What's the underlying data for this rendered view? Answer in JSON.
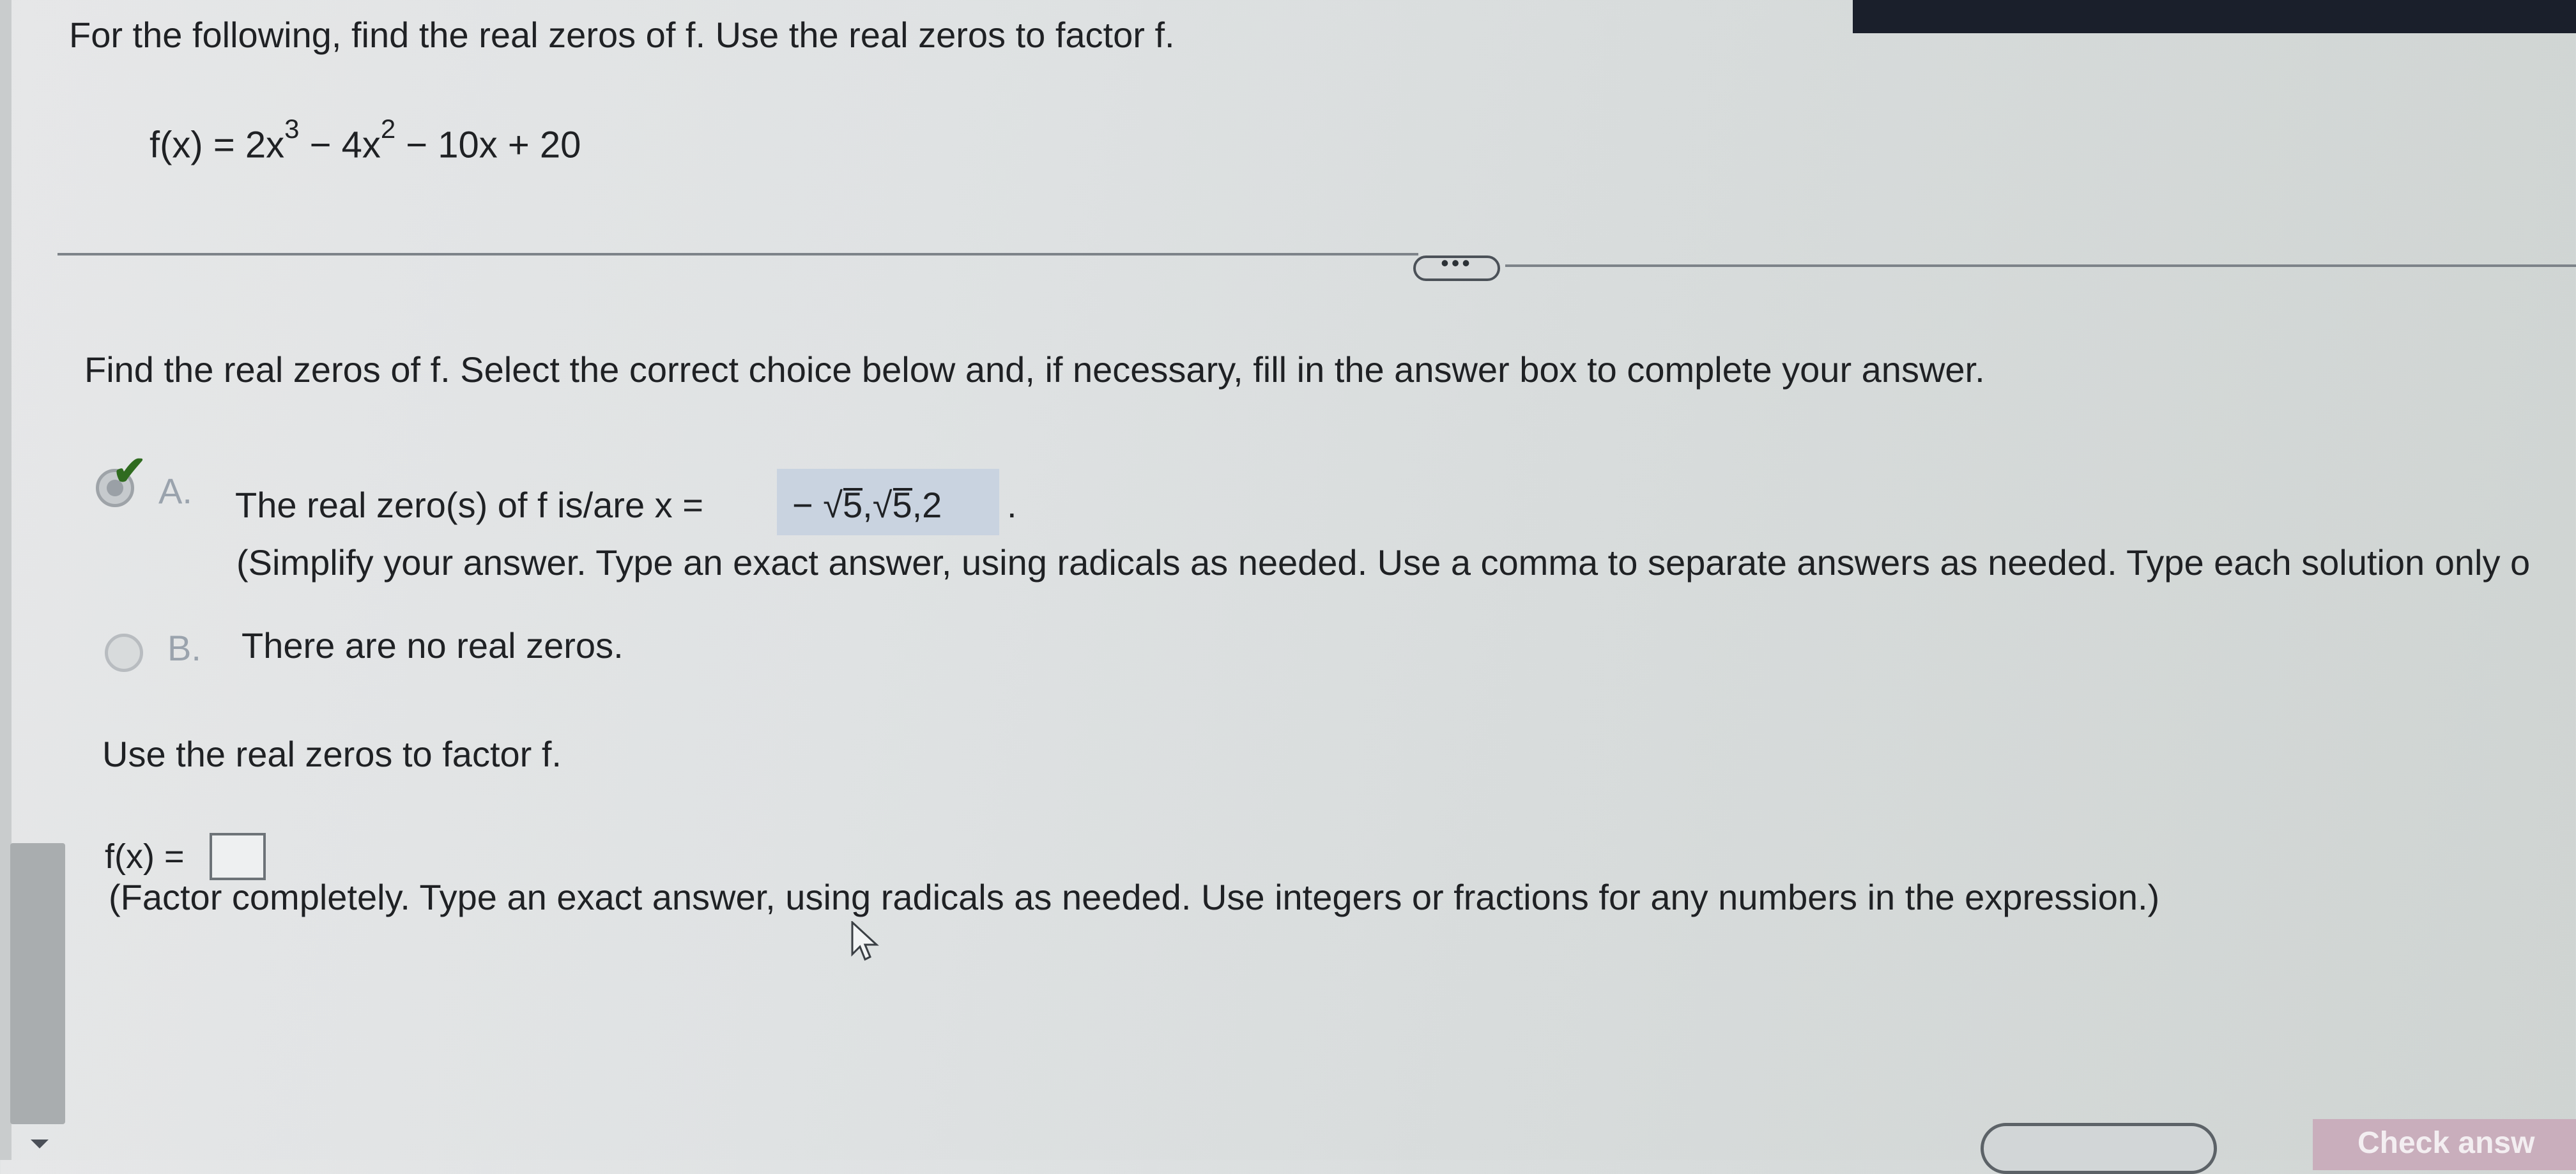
{
  "question": {
    "title": "For the following, find the real zeros of f. Use the real zeros to factor f.",
    "function_prefix": "f(x) = 2x",
    "exp1": "3",
    "mid": " − 4x",
    "exp2": "2",
    "suffix": " − 10x + 20"
  },
  "more_button_label": "•••",
  "part1": {
    "instruction": "Find the real zeros of f. Select the correct choice below and, if necessary, fill in the answer box to complete your answer.",
    "option_a": {
      "letter": "A.",
      "text": "The real zero(s) of f is/are x =",
      "answer_minus": "−",
      "answer_r1": "5",
      "answer_comma1": ",",
      "answer_r2": "5",
      "answer_tail": ",2",
      "period": ".",
      "note": "(Simplify your answer. Type an exact answer, using radicals as needed. Use a comma to separate answers as needed. Type each solution only o",
      "selected": true,
      "status": "correct"
    },
    "option_b": {
      "letter": "B.",
      "text": "There are no real zeros.",
      "selected": false
    }
  },
  "part2": {
    "instruction": "Use the real zeros to factor f.",
    "label": "f(x) =",
    "value": "",
    "note": "(Factor completely. Type an exact answer, using radicals as needed. Use integers or fractions for any numbers in the expression.)"
  },
  "check_answer_label": "Check answ",
  "colors": {
    "answer_highlight": "#c9d3e0",
    "correct_check": "#2f6b1f",
    "check_button": "#c9aebc"
  }
}
